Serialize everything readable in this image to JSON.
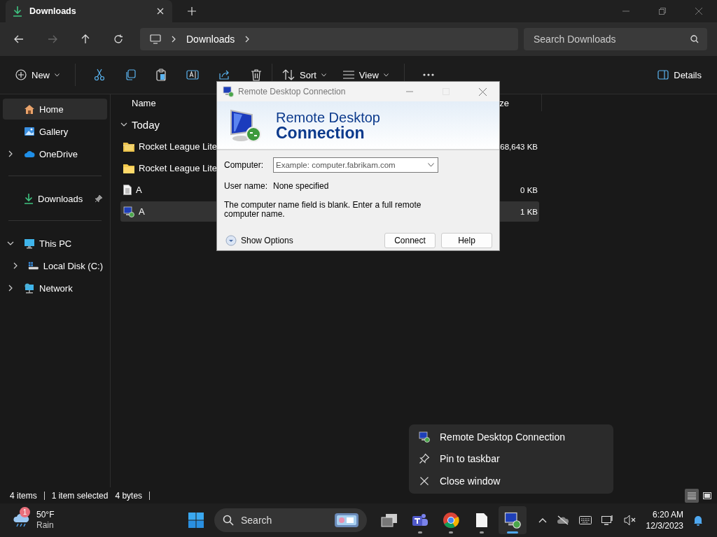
{
  "tab": {
    "title": "Downloads"
  },
  "address": {
    "crumbs": [
      "Downloads"
    ],
    "search_placeholder": "Search Downloads"
  },
  "commands": {
    "new": "New",
    "sort": "Sort",
    "view": "View",
    "details": "Details"
  },
  "sidebar": {
    "groups": [
      [
        {
          "label": "Home",
          "kind": "home",
          "selected": true
        },
        {
          "label": "Gallery",
          "kind": "gallery",
          "selected": false
        },
        {
          "label": "OneDrive",
          "kind": "cloud",
          "selected": false,
          "expanded": false
        }
      ],
      [
        {
          "label": "Downloads",
          "kind": "download",
          "selected": false,
          "pinned": true
        }
      ],
      [
        {
          "label": "This PC",
          "kind": "pc",
          "selected": false,
          "expanded": true,
          "children": [
            {
              "label": "Local Disk (C:)",
              "kind": "disk",
              "selected": false,
              "expanded": false
            }
          ]
        },
        {
          "label": "Network",
          "kind": "network",
          "selected": false,
          "expanded": false
        }
      ]
    ]
  },
  "files": {
    "columns": [
      "Name",
      "ze"
    ],
    "group": {
      "label": "Today",
      "expanded": true
    },
    "rows": [
      {
        "name": "Rocket League Lite",
        "kind": "zip",
        "size": "68,643 KB",
        "selected": false
      },
      {
        "name": "Rocket League Lite",
        "kind": "folder",
        "selected": false
      },
      {
        "name": "A",
        "kind": "text",
        "size": "0 KB",
        "selected": false
      },
      {
        "name": "A",
        "kind": "rdp",
        "size": "1 KB",
        "selected": true
      }
    ]
  },
  "dialog": {
    "title": "Remote Desktop Connection",
    "heading_line1": "Remote Desktop",
    "heading_line2": "Connection",
    "computer_label": "Computer:",
    "computer_placeholder": "Example: computer.fabrikam.com",
    "username_label": "User name:",
    "username_value": "None specified",
    "message": "The computer name field is blank. Enter a full remote computer name.",
    "show_options": "Show Options",
    "buttons": [
      "Connect",
      "Help"
    ]
  },
  "status_bar": {
    "count": "4 items",
    "selection": "1 item selected",
    "size": "4 bytes",
    "views": [
      {
        "kind": "details",
        "selected": true
      },
      {
        "kind": "tiles",
        "selected": false
      }
    ]
  },
  "context_menu": [
    {
      "label": "Remote Desktop Connection",
      "kind": "app"
    },
    {
      "label": "Pin to taskbar",
      "kind": "pin"
    },
    {
      "label": "Close window",
      "kind": "close"
    }
  ],
  "taskbar": {
    "weather": {
      "badge": "1",
      "temperature": "50°F",
      "condition": "Rain"
    },
    "search": "Search",
    "apps": [
      {
        "kind": "taskview",
        "running": false,
        "active": false
      },
      {
        "kind": "teams",
        "running": true,
        "active": false
      },
      {
        "kind": "chrome",
        "running": true,
        "active": false
      },
      {
        "kind": "file",
        "running": true,
        "active": false
      },
      {
        "kind": "rdp",
        "running": true,
        "active": true
      }
    ],
    "time": "6:20 AM",
    "date": "12/3/2023"
  }
}
